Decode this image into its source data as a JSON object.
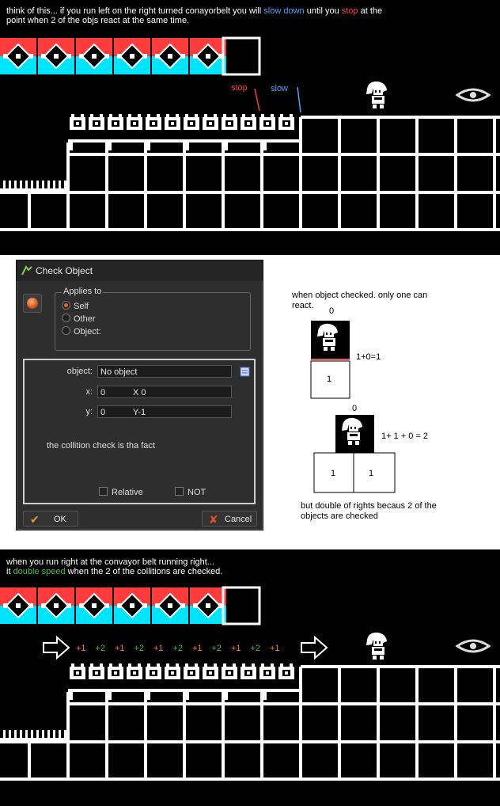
{
  "colors": {
    "white": "#ffffff",
    "black": "#000000",
    "red": "#ff3b3b",
    "blue": "#4aa3ff",
    "green": "#43c243",
    "cyan": "#00e5ff",
    "orange": "#ff7a3a"
  },
  "panel1": {
    "caption_parts": [
      "think of this... if you run left on the right turned conayorbelt you will ",
      "slow down",
      " until you ",
      "stop",
      " at the"
    ],
    "caption_line2": "point when 2 of the objs react at the same time.",
    "stop_label": "stop",
    "slow_label": "slow"
  },
  "dialog": {
    "title": "Check Object",
    "applies_to": "Applies to",
    "options": [
      "Self",
      "Other",
      "Object:"
    ],
    "selected_option": "Self",
    "object_label": "object:",
    "object_value": "No object",
    "x_label": "x:",
    "x_value": "0",
    "x_hint": "X 0",
    "y_label": "y:",
    "y_value": "0",
    "y_hint": "Y-1",
    "note": "the collition check is tha fact",
    "relative_label": "Relative",
    "not_label": "NOT",
    "ok_label": "OK",
    "cancel_label": "Cancel"
  },
  "explain": {
    "line1": "when object checked. only one can",
    "line2": "react.",
    "top_count": "0",
    "single_box": "1",
    "single_eq": "1+0=1",
    "double_count": "0",
    "double_box_left": "1",
    "double_box_right": "1",
    "double_eq": "1+ 1 + 0 = 2",
    "bottom1": "but double of rights becaus 2 of the",
    "bottom2": "objects are checked"
  },
  "panel3": {
    "caption_line1": "when you run right at the convayor belt running right...",
    "caption_parts": [
      "it ",
      "double speed",
      " when the 2 of the collitions are checked."
    ],
    "counters": [
      "+1",
      "+2",
      "+1",
      "+2",
      "+1",
      "+2",
      "+1",
      "+2",
      "+1",
      "+2",
      "+1"
    ]
  }
}
